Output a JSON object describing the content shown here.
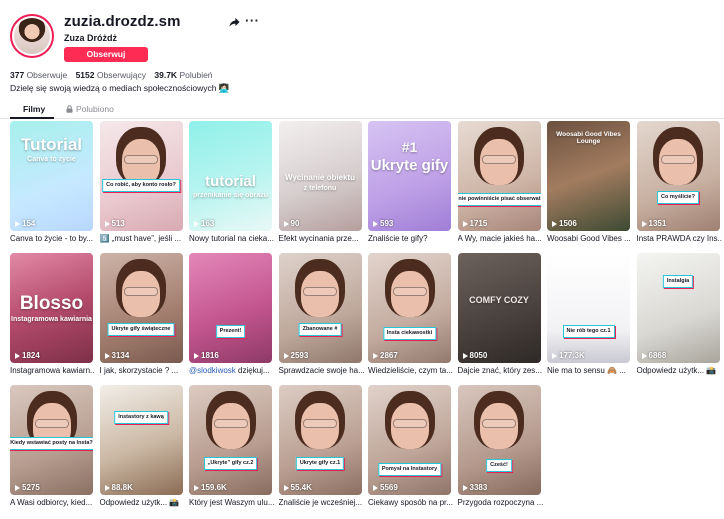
{
  "profile": {
    "username": "zuzia.drozdz.sm",
    "nickname": "Zuza Dróżdż",
    "follow_label": "Obserwuj",
    "bio": "Dzielę się swoją wiedzą o mediach społecznościowych 👩🏻‍💻"
  },
  "stats": {
    "following_count": "377",
    "following_label": "Obserwuje",
    "followers_count": "5152",
    "followers_label": "Obserwujący",
    "likes_count": "39.7K",
    "likes_label": "Polubień"
  },
  "tabs": {
    "videos": "Filmy",
    "liked": "Polubiono"
  },
  "icons": {
    "share": "share-arrow-icon",
    "more": "more-dots-icon",
    "lock": "lock-icon",
    "play": "play-icon"
  },
  "videos": [
    {
      "views": "154",
      "caption": "Canva to życie - to by...",
      "overlay": "Tutorial",
      "sub": "Canva to życie"
    },
    {
      "views": "513",
      "caption": "5️⃣ „must have”, jeśli ...",
      "overlay": "Co robić, aby konto rosło?"
    },
    {
      "views": "163",
      "caption": "Nowy tutorial na cieka...",
      "overlay": "tutorial",
      "sub": "przenikanie się obrazu"
    },
    {
      "views": "90",
      "caption": "Efekt wycinania prze...",
      "overlay": "Wycinanie obiektu",
      "sub": "z telefonu"
    },
    {
      "views": "593",
      "caption": "Znaliście te gify?",
      "overlay": "Ukryte gify",
      "sub": "#1"
    },
    {
      "views": "1715",
      "caption": "A Wy, macie jakieś ha...",
      "overlay": "Czego nie powinniście pisać obserwatorom?"
    },
    {
      "views": "1506",
      "caption": "Woosabi Good Vibes ...",
      "overlay": "Woosabi Good Vibes Lounge"
    },
    {
      "views": "1351",
      "caption": "Insta PRAWDA czy Ins...",
      "overlay": "Co myślicie?"
    },
    {
      "views": "1824",
      "caption": "Instagramowa kawiarn...",
      "overlay": "Blosso",
      "sub": "Instagramowa kawiarnia"
    },
    {
      "views": "3134",
      "caption": "I jak, skorzystacie ? ...",
      "overlay": "Ukryte gify świąteczne"
    },
    {
      "views": "1816",
      "caption": "@slodkiwosk dziękuj...",
      "mention": "@slodkiwosk",
      "rest": " dziękuj...",
      "overlay": "Prezent!"
    },
    {
      "views": "2593",
      "caption": "Sprawdzacie swoje ha...",
      "overlay": "Zbanowane #"
    },
    {
      "views": "2867",
      "caption": "Wiedzieliście, czym ta...",
      "overlay": "Insta ciekawostki"
    },
    {
      "views": "8050",
      "caption": "Dajcie znać, który zes...",
      "overlay": "COMFY COZY"
    },
    {
      "views": "177.3K",
      "caption": "Nie ma to sensu 🙈 ...",
      "overlay": "Nie rób tego cz.1"
    },
    {
      "views": "6868",
      "caption": "Odpowiedz użytk... 📸",
      "overlay": "Instalgia"
    },
    {
      "views": "5275",
      "caption": "A Wasi odbiorcy, kied...",
      "overlay": "Kiedy wstawiać posty na Insta?"
    },
    {
      "views": "88.8K",
      "caption": "Odpowiedz użytk... 📸",
      "overlay": "Instastory z kawą"
    },
    {
      "views": "159.6K",
      "caption": "Który jest Waszym ulu...",
      "overlay": "„Ukryte” gify cz.2"
    },
    {
      "views": "55.4K",
      "caption": "Znaliście je wcześniej...",
      "overlay": "Ukryte gify cz.1"
    },
    {
      "views": "5569",
      "caption": "Ciekawy sposób na pr...",
      "overlay": "Pomysł na Instastory"
    },
    {
      "views": "3383",
      "caption": "Przygoda rozpoczyna ...",
      "overlay": "Cześć!"
    }
  ],
  "colors": {
    "accent": "#fe2c55",
    "tag_border": "#24c6d8",
    "tag_shadow": "#ee1d52",
    "mention": "#2b5db9"
  }
}
